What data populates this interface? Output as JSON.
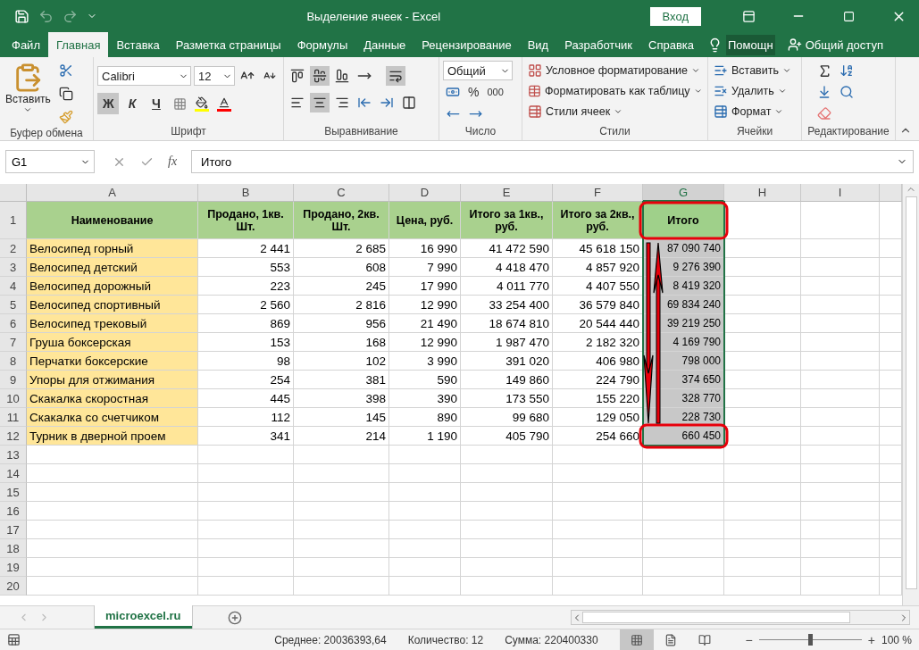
{
  "window": {
    "title": "Выделение ячеек - Excel",
    "signin": "Вход"
  },
  "ribbon_tabs": [
    {
      "label": "Файл",
      "selected": false
    },
    {
      "label": "Главная",
      "selected": true
    },
    {
      "label": "Вставка",
      "selected": false
    },
    {
      "label": "Разметка страницы",
      "selected": false
    },
    {
      "label": "Формулы",
      "selected": false
    },
    {
      "label": "Данные",
      "selected": false
    },
    {
      "label": "Рецензирование",
      "selected": false
    },
    {
      "label": "Вид",
      "selected": false
    },
    {
      "label": "Разработчик",
      "selected": false
    },
    {
      "label": "Справка",
      "selected": false
    }
  ],
  "help": "Помощн",
  "share": "Общий доступ",
  "ribbon": {
    "clipboard": {
      "paste": "Вставить",
      "group": "Буфер обмена"
    },
    "font": {
      "name": "Calibri",
      "size": "12",
      "styles": [
        {
          "label": "Ж",
          "selected": true
        },
        {
          "label": "К",
          "selected": false
        },
        {
          "label": "Ч",
          "selected": false
        }
      ],
      "group": "Шрифт"
    },
    "alignment": {
      "vertical": [
        {
          "selected": false
        },
        {
          "selected": true
        },
        {
          "selected": false
        }
      ],
      "horizontal": [
        {
          "selected": false
        },
        {
          "selected": true
        },
        {
          "selected": false
        }
      ],
      "wrap": {
        "selected": true
      },
      "group": "Выравнивание"
    },
    "number": {
      "format": "Общий",
      "percent": "%",
      "thousands": "000",
      "group": "Число"
    },
    "styles": {
      "items": [
        "Условное форматирование",
        "Форматировать как таблицу",
        "Стили ячеек"
      ],
      "group": "Стили"
    },
    "cells": {
      "items": [
        "Вставить",
        "Удалить",
        "Формат"
      ],
      "group": "Ячейки"
    },
    "editing": {
      "group": "Редактирование"
    }
  },
  "formula_bar": {
    "name_box": "G1",
    "fx": "fx",
    "value": "Итого"
  },
  "sheet": {
    "columns": [
      {
        "label": "A",
        "selected": false
      },
      {
        "label": "B",
        "selected": false
      },
      {
        "label": "C",
        "selected": false
      },
      {
        "label": "D",
        "selected": false
      },
      {
        "label": "E",
        "selected": false
      },
      {
        "label": "F",
        "selected": false
      },
      {
        "label": "G",
        "selected": true
      },
      {
        "label": "H",
        "selected": false
      },
      {
        "label": "I",
        "selected": false
      }
    ],
    "header_row": {
      "number": "1",
      "cells": [
        "Наименование",
        "Продано, 1кв. Шт.",
        "Продано, 2кв. Шт.",
        "Цена, руб.",
        "Итого за 1кв., руб.",
        "Итого за 2кв., руб.",
        "Итого"
      ]
    },
    "rows": [
      {
        "number": "2",
        "cells": [
          "Велосипед горный",
          "2 441",
          "2 685",
          "16 990",
          "41 472 590",
          "45 618 150",
          "87 090 740"
        ]
      },
      {
        "number": "3",
        "cells": [
          "Велосипед детский",
          "553",
          "608",
          "7 990",
          "4 418 470",
          "4 857 920",
          "9 276 390"
        ]
      },
      {
        "number": "4",
        "cells": [
          "Велосипед дорожный",
          "223",
          "245",
          "17 990",
          "4 011 770",
          "4 407 550",
          "8 419 320"
        ]
      },
      {
        "number": "5",
        "cells": [
          "Велосипед спортивный",
          "2 560",
          "2 816",
          "12 990",
          "33 254 400",
          "36 579 840",
          "69 834 240"
        ]
      },
      {
        "number": "6",
        "cells": [
          "Велосипед трековый",
          "869",
          "956",
          "21 490",
          "18 674 810",
          "20 544 440",
          "39 219 250"
        ]
      },
      {
        "number": "7",
        "cells": [
          "Груша боксерская",
          "153",
          "168",
          "12 990",
          "1 987 470",
          "2 182 320",
          "4 169 790"
        ]
      },
      {
        "number": "8",
        "cells": [
          "Перчатки боксерские",
          "98",
          "102",
          "3 990",
          "391 020",
          "406 980",
          "798 000"
        ]
      },
      {
        "number": "9",
        "cells": [
          "Упоры для отжимания",
          "254",
          "381",
          "590",
          "149 860",
          "224 790",
          "374 650"
        ]
      },
      {
        "number": "10",
        "cells": [
          "Скакалка скоростная",
          "445",
          "398",
          "390",
          "173 550",
          "155 220",
          "328 770"
        ]
      },
      {
        "number": "11",
        "cells": [
          "Скакалка со счетчиком",
          "112",
          "145",
          "890",
          "99 680",
          "129 050",
          "228 730"
        ]
      },
      {
        "number": "12",
        "cells": [
          "Турник в дверной проем",
          "341",
          "214",
          "1 190",
          "405 790",
          "254 660",
          "660 450"
        ]
      }
    ],
    "empty_rows": [
      "13",
      "14",
      "15",
      "16",
      "17",
      "18",
      "19",
      "20"
    ]
  },
  "sheet_tabs": [
    {
      "label": "microexcel.ru",
      "selected": true
    }
  ],
  "status_bar": {
    "average": "Среднее: 20036393,64",
    "count": "Количество: 12",
    "sum": "Сумма: 220400330",
    "views": [
      {
        "selected": true
      },
      {
        "selected": false
      },
      {
        "selected": false
      }
    ],
    "zoom_out": "−",
    "zoom_in": "+",
    "zoom": {
      "level": 0.5
    },
    "zoom_label": "100 %"
  }
}
